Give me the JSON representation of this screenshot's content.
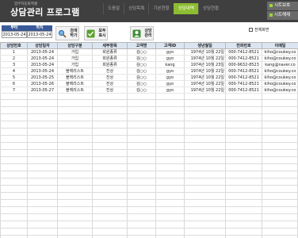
{
  "header": {
    "subtitle": "업무자동화엑셀",
    "title": "상담관리 프로그램"
  },
  "nav": [
    {
      "label": "도움말",
      "active": false
    },
    {
      "label": "상담목록",
      "active": false
    },
    {
      "label": "기본현황",
      "active": false
    },
    {
      "label": "상담내역",
      "active": true
    },
    {
      "label": "상담현황",
      "active": false
    }
  ],
  "side_buttons": {
    "view": "시트보호",
    "release": "시트해제"
  },
  "filter": {
    "from_label": "부터",
    "from_value": "2013-05-24",
    "to_label": "까지",
    "to_value": "2013-05-24"
  },
  "toolbar": {
    "search": "검색\n하기",
    "show_all": "모두\n표시",
    "consult_register": "상담\n관리"
  },
  "view_all": {
    "label": "전체화면",
    "checked": false
  },
  "colors": {
    "header_bg": "#3f3f3f",
    "nav_active": "#8cbc2f",
    "date_label": "#3b5a99",
    "table_header": "#dbe5f1"
  },
  "table": {
    "columns": [
      "상담번호",
      "상담일자",
      "상담구분",
      "세부항목",
      "고객명",
      "고객ID",
      "생년월일",
      "전화번호",
      "이메일"
    ],
    "rows": [
      [
        "1",
        "2013-05-24",
        "가입",
        "회원종류",
        "김○○",
        "gyo",
        "1974년 10월 22일",
        "000-7412-8521",
        "kiho@coukey.co"
      ],
      [
        "2",
        "2013-05-24",
        "가입",
        "회원종류",
        "김○○",
        "gyo",
        "1974년 10월 22일",
        "000-7412-8521",
        "kiho@coukey.co"
      ],
      [
        "3",
        "2013-05-24",
        "가입",
        "회원종류",
        "김○○",
        "kang",
        "1974년 10월 23일",
        "000-9632-8523",
        "kang@naver.co"
      ],
      [
        "4",
        "2013-05-24",
        "블랙리스트",
        "진상",
        "김○○",
        "gyo",
        "1974년 10월 22일",
        "000-7412-8521",
        "kiho@coukey.co"
      ],
      [
        "5",
        "2013-05-25",
        "블랙리스트",
        "진상",
        "김○○",
        "gyo",
        "1974년 10월 22일",
        "000-7412-8521",
        "kiho@coukey.co"
      ],
      [
        "6",
        "2013-05-26",
        "블랙리스트",
        "진상",
        "김○○",
        "gyo",
        "1974년 10월 22일",
        "000-7412-8521",
        "kiho@coukey.co"
      ],
      [
        "7",
        "2013-05-27",
        "블랙리스트",
        "진상",
        "김○○",
        "gyo",
        "1974년 10월 22일",
        "000-7412-8521",
        "kiho@coukey.co"
      ]
    ]
  }
}
